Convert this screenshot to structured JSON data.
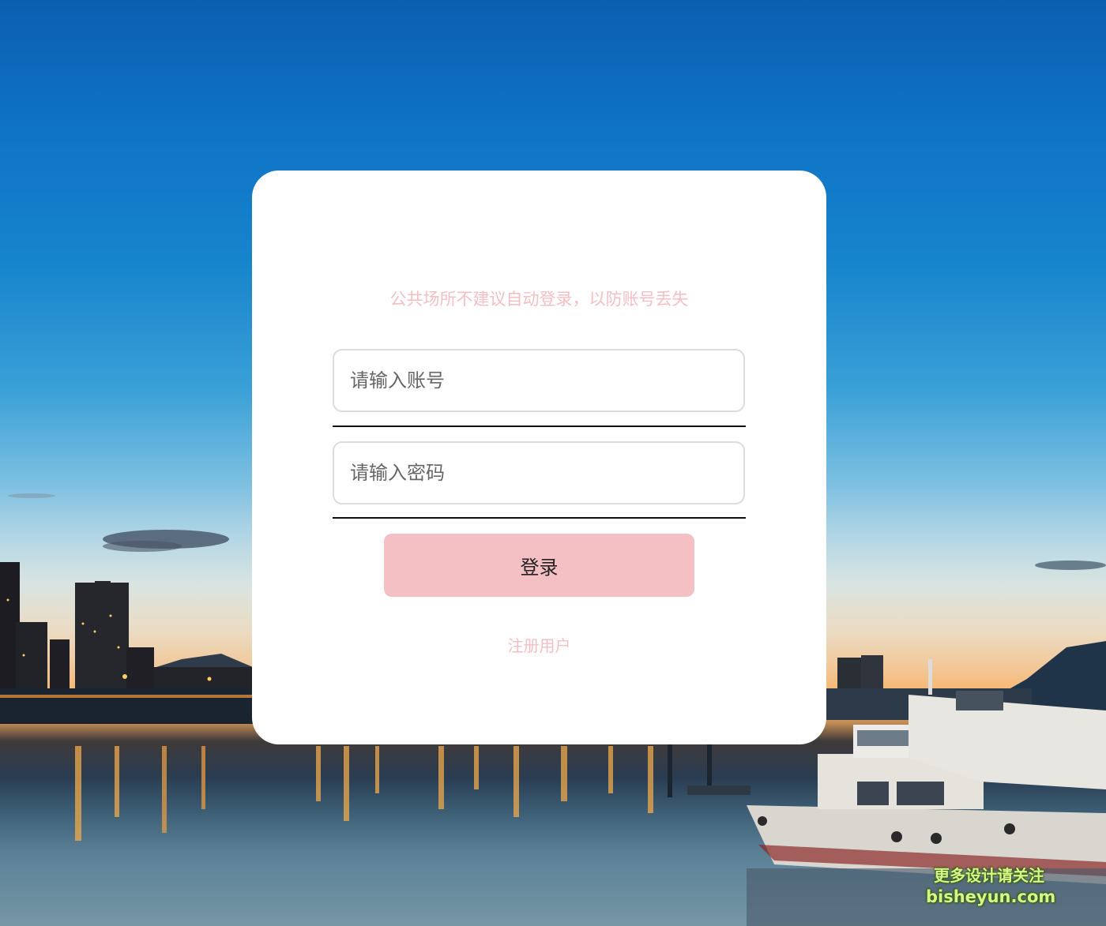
{
  "login": {
    "notice": "公共场所不建议自动登录，以防账号丢失",
    "account_placeholder": "请输入账号",
    "password_placeholder": "请输入密码",
    "login_button": "登录",
    "register_link": "注册用户"
  },
  "watermark": {
    "line1": "更多设计请关注",
    "line2": "bisheyun.com"
  },
  "colors": {
    "accent_pink": "#f4c0c3",
    "notice_pink": "#f5bfc2",
    "card_bg": "#ffffff"
  }
}
